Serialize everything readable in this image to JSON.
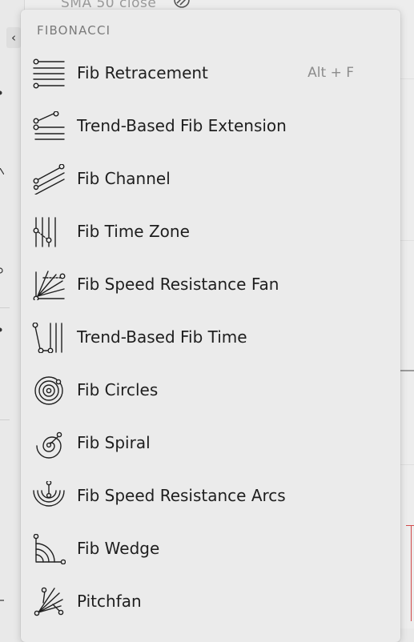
{
  "background": {
    "topbar_text": "SMA 50 close",
    "collapse_glyph": "‹"
  },
  "menu": {
    "section_title": "FIBONACCI",
    "items": [
      {
        "label": "Fib Retracement",
        "shortcut": "Alt + F",
        "icon": "fib-retracement-icon"
      },
      {
        "label": "Trend-Based Fib Extension",
        "icon": "trend-based-fib-extension-icon"
      },
      {
        "label": "Fib Channel",
        "icon": "fib-channel-icon"
      },
      {
        "label": "Fib Time Zone",
        "icon": "fib-time-zone-icon"
      },
      {
        "label": "Fib Speed Resistance Fan",
        "icon": "fib-speed-resistance-fan-icon"
      },
      {
        "label": "Trend-Based Fib Time",
        "icon": "trend-based-fib-time-icon"
      },
      {
        "label": "Fib Circles",
        "icon": "fib-circles-icon"
      },
      {
        "label": "Fib Spiral",
        "icon": "fib-spiral-icon"
      },
      {
        "label": "Fib Speed Resistance Arcs",
        "icon": "fib-speed-resistance-arcs-icon"
      },
      {
        "label": "Fib Wedge",
        "icon": "fib-wedge-icon"
      },
      {
        "label": "Pitchfan",
        "icon": "pitchfan-icon"
      }
    ]
  },
  "colors": {
    "menu_bg": "#ebebeb",
    "text": "#1e1e1e",
    "section_title": "#7a7a7a",
    "shortcut": "#8c8c8c",
    "accent_red": "#d24b4b"
  }
}
